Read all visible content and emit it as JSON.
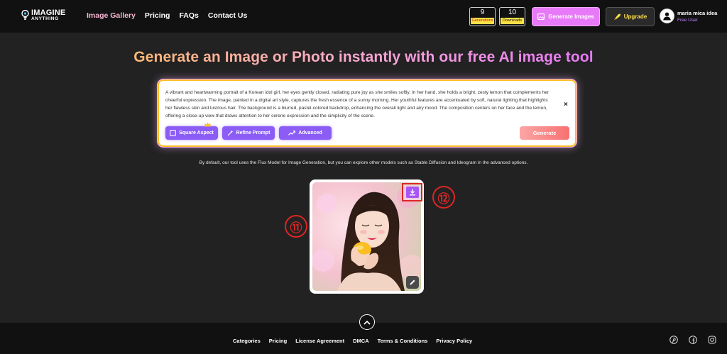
{
  "header": {
    "logo": {
      "line1": "IMAGINE",
      "line2": "ANYTHING"
    },
    "nav": [
      {
        "label": "Image Gallery",
        "active": true
      },
      {
        "label": "Pricing"
      },
      {
        "label": "FAQs"
      },
      {
        "label": "Contact Us"
      }
    ],
    "generations": {
      "count": "9",
      "label": "Generations"
    },
    "downloads": {
      "count": "10",
      "label": "Downloads"
    },
    "generate_images_label": "Generate Images",
    "upgrade_label": "Upgrade",
    "user": {
      "name": "maria mica idea",
      "role": "Free User"
    }
  },
  "hero": {
    "headline": "Generate an Image or Photo instantly with our free AI image tool"
  },
  "prompt": {
    "text": "A vibrant and heartwarming portrait of a Korean idol girl, her eyes gently closed, radiating pure joy as she smiles softly. In her hand, she holds a bright, zesty lemon that complements her cheerful expression. The image, painted in a digital art style, captures the fresh essence of a sunny morning. Her youthful features are accentuated by soft, natural lighting that highlights her flawless skin and lustrous hair. The background is a blurred, pastel-colored backdrop, enhancing the overall light and airy mood. The composition centers on her face and the lemon, offering a close-up view that draws attention to her serene expression and the simplicity of the scene.",
    "close_symbol": "×",
    "buttons": {
      "square_aspect": "Square Aspect",
      "refine_prompt": "Refine Prompt",
      "advanced": "Advanced",
      "generate": "Generate"
    }
  },
  "info_text": "By default, our tool uses the Flux Model for Image Generation, but you can explore other models such as Stable Diffusion and Ideogram in the advanced options.",
  "markers": {
    "image": "⑪",
    "download": "⑫"
  },
  "footer": {
    "links": [
      "Categories",
      "Pricing",
      "License Agreement",
      "DMCA",
      "Terms & Conditions",
      "Privacy Policy"
    ],
    "social": [
      "pinterest-icon",
      "facebook-icon",
      "instagram-icon"
    ]
  },
  "colors": {
    "accent_pink": "#e879f9",
    "accent_purple": "#8b5cf6",
    "generate_red": "#f87171",
    "marker_red": "#dc2626"
  }
}
